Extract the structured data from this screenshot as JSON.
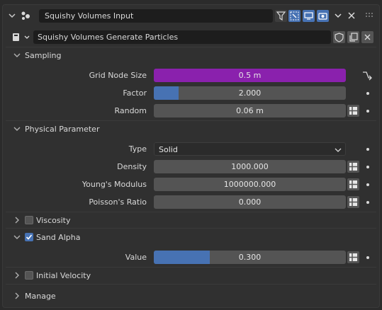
{
  "header": {
    "node_title": "Squishy Volumes Input",
    "node_tree_name": "Squishy Volumes Generate Particles"
  },
  "sections": {
    "sampling": "Sampling",
    "physical": "Physical Parameter",
    "viscosity": "Viscosity",
    "sand_alpha": "Sand Alpha",
    "initial_velocity": "Initial Velocity",
    "manage": "Manage"
  },
  "fields": {
    "grid_node_size": {
      "label": "Grid Node Size",
      "value": "0.5 m"
    },
    "factor": {
      "label": "Factor",
      "value": "2.000",
      "fill_fraction": 0.13
    },
    "random": {
      "label": "Random",
      "value": "0.06 m"
    },
    "type": {
      "label": "Type",
      "value": "Solid"
    },
    "density": {
      "label": "Density",
      "value": "1000.000"
    },
    "youngs_modulus": {
      "label": "Young's Modulus",
      "value": "1000000.000"
    },
    "poissons_ratio": {
      "label": "Poisson's Ratio",
      "value": "0.000"
    },
    "sand_value": {
      "label": "Value",
      "value": "0.300",
      "fill_fraction": 0.3
    }
  },
  "checkboxes": {
    "viscosity": false,
    "sand_alpha": true,
    "initial_velocity": false
  },
  "colors": {
    "grid_node_fill": "#8a21ad",
    "slider_fill": "#4772b3",
    "accent": "#4772b3"
  }
}
